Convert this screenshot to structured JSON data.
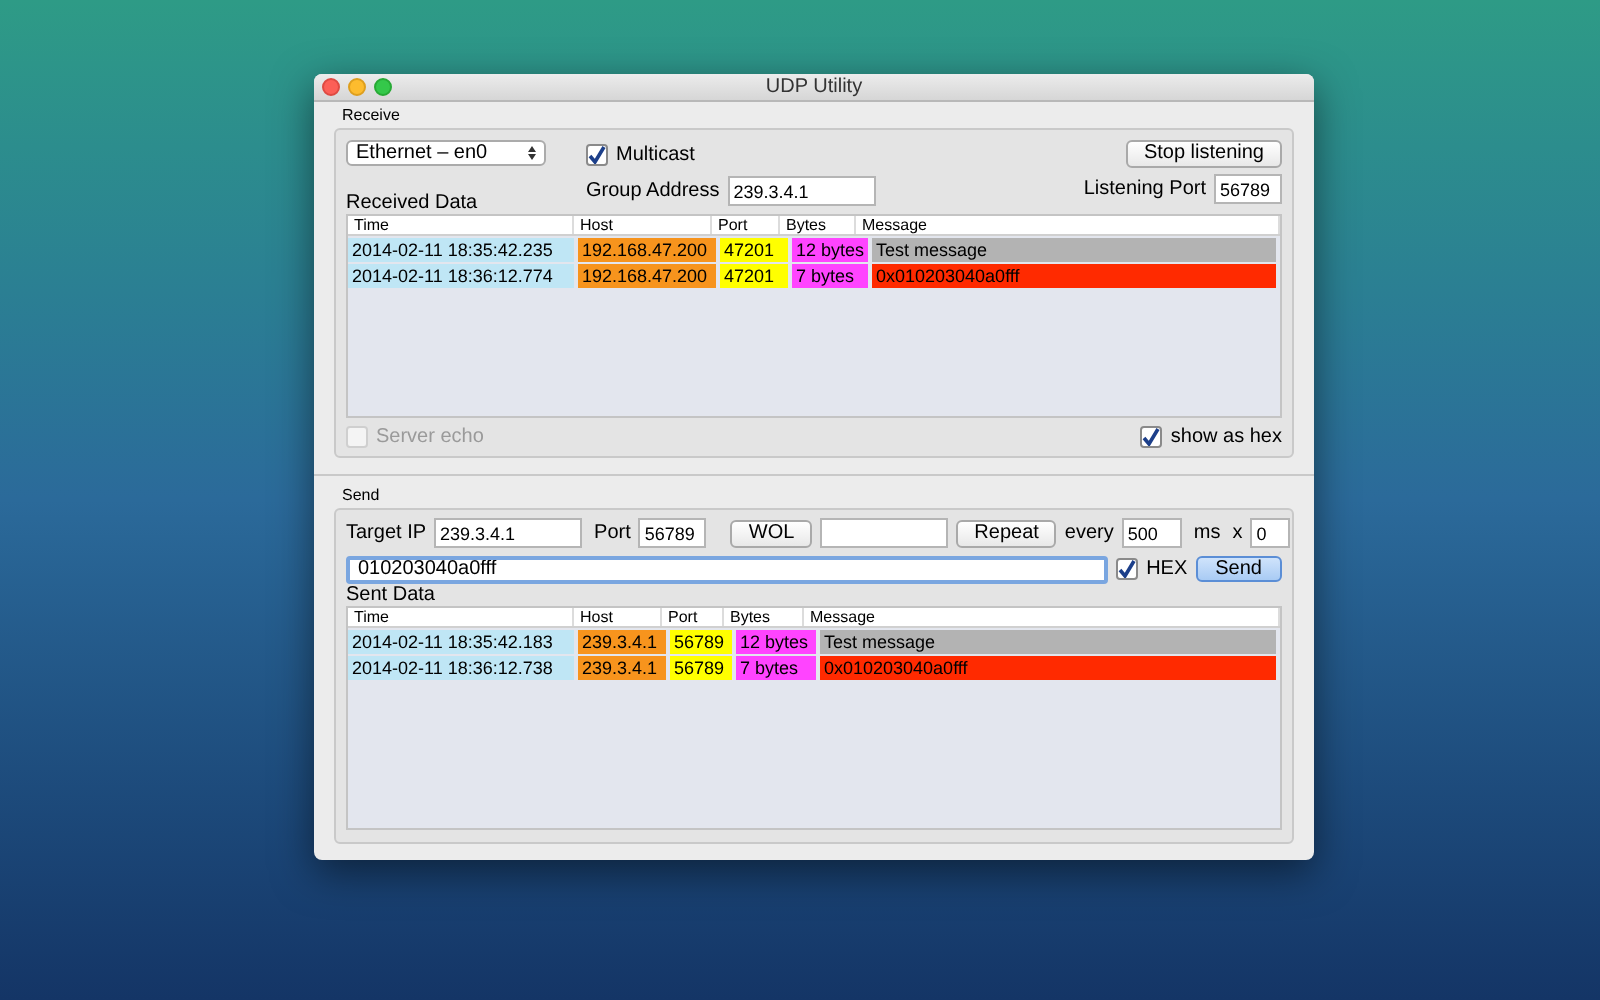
{
  "window": {
    "title": "UDP Utility"
  },
  "receive": {
    "label": "Receive",
    "interface": "Ethernet – en0",
    "multicast": {
      "label": "Multicast",
      "checked": true
    },
    "group_address": {
      "label": "Group Address",
      "value": "239.3.4.1"
    },
    "stop_button": "Stop listening",
    "listening_port": {
      "label": "Listening Port",
      "value": "56789"
    },
    "table_title": "Received Data",
    "columns": [
      "Time",
      "Host",
      "Port",
      "Bytes",
      "Message"
    ],
    "rows": [
      {
        "time": "2014-02-11 18:35:42.235",
        "host": "192.168.47.200",
        "port": "47201",
        "bytes": "12 bytes",
        "message": "Test message",
        "kind": "text"
      },
      {
        "time": "2014-02-11 18:36:12.774",
        "host": "192.168.47.200",
        "port": "47201",
        "bytes": "7 bytes",
        "message": "0x010203040a0fff",
        "kind": "hex"
      }
    ],
    "server_echo": {
      "label": "Server echo",
      "checked": false,
      "disabled": true
    },
    "show_as_hex": {
      "label": "show as hex",
      "checked": true,
      "disabled": false
    }
  },
  "send": {
    "label": "Send",
    "target_ip": {
      "label": "Target IP",
      "value": "239.3.4.1"
    },
    "port": {
      "label": "Port",
      "value": "56789"
    },
    "wol_button": "WOL",
    "repeat_button": "Repeat",
    "every": {
      "label": "every",
      "value": "500"
    },
    "ms_label": "ms",
    "times": {
      "label": "x",
      "value": "0"
    },
    "message": "010203040a0fff",
    "hex": {
      "label": "HEX",
      "checked": true
    },
    "send_button": "Send",
    "table_title": "Sent Data",
    "columns": [
      "Time",
      "Host",
      "Port",
      "Bytes",
      "Message"
    ],
    "rows": [
      {
        "time": "2014-02-11 18:35:42.183",
        "host": "239.3.4.1",
        "port": "56789",
        "bytes": "12 bytes",
        "message": "Test message",
        "kind": "text"
      },
      {
        "time": "2014-02-11 18:36:12.738",
        "host": "239.3.4.1",
        "port": "56789",
        "bytes": "7 bytes",
        "message": "0x010203040a0fff",
        "kind": "hex"
      }
    ]
  }
}
